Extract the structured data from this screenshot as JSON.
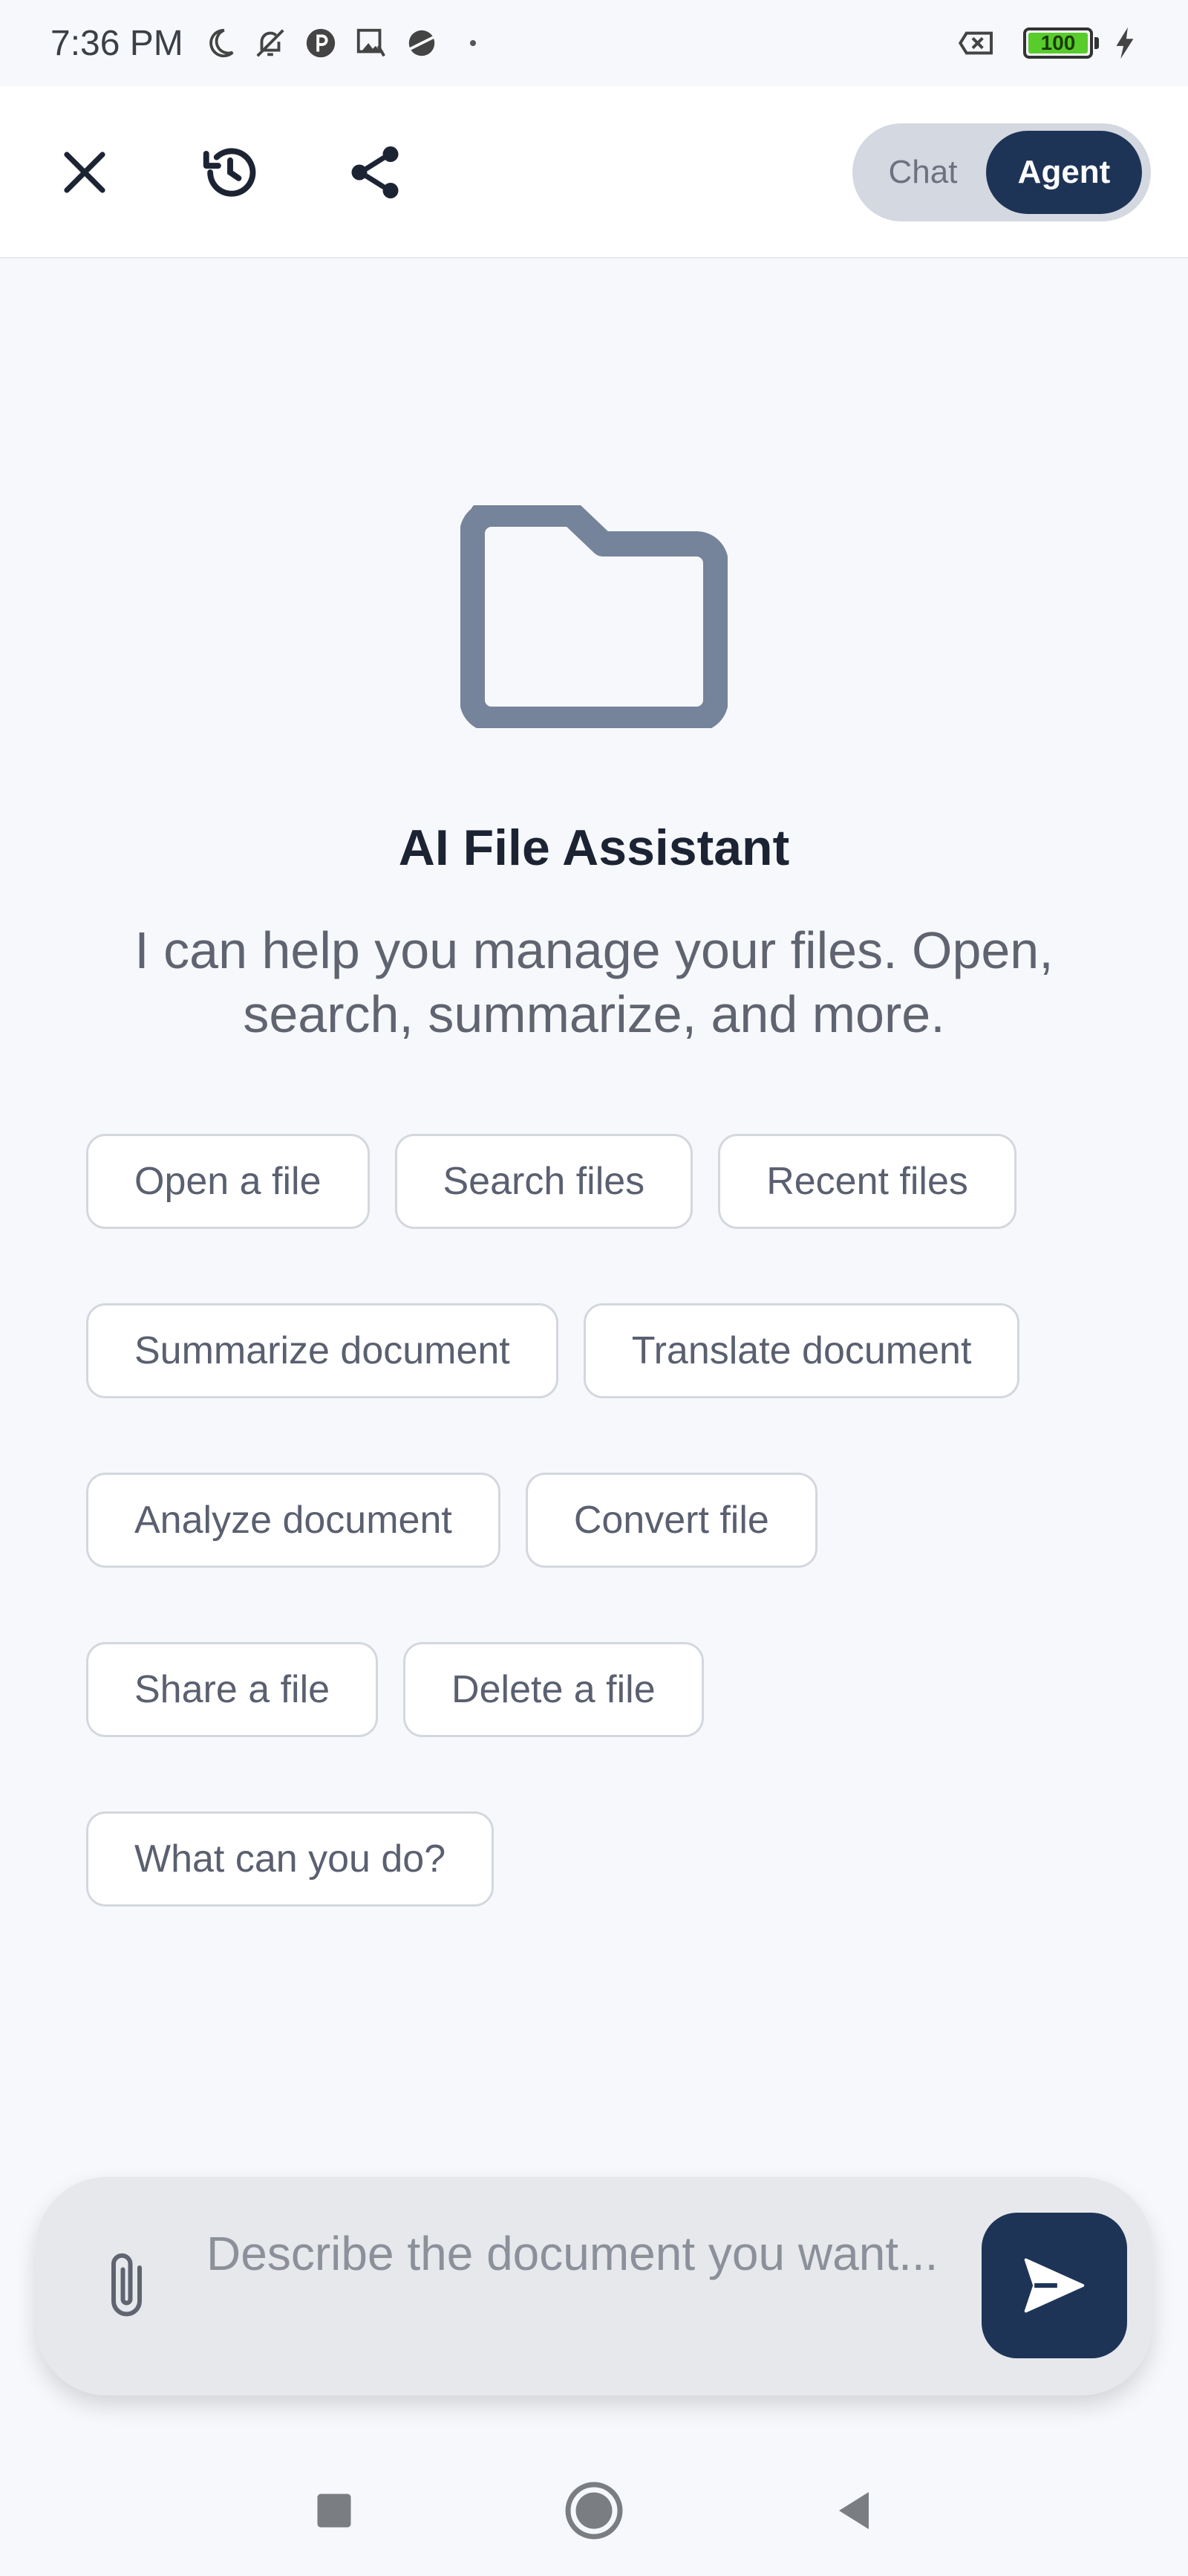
{
  "status_bar": {
    "time": "7:36 PM",
    "battery_level": "100",
    "icons": [
      "moon-icon",
      "bell-off-icon",
      "circle-p-icon",
      "image-icon",
      "planet-icon",
      "sim-off-icon",
      "charging-bolt-icon"
    ]
  },
  "app_bar": {
    "icons": [
      "close-icon",
      "history-icon",
      "share-icon"
    ],
    "mode_toggle": {
      "options": [
        "Chat",
        "Agent"
      ],
      "selected": "Agent"
    }
  },
  "hero": {
    "icon": "folder-icon",
    "title": "AI File Assistant",
    "subtitle": "I can help you manage your files. Open, search, summarize, and more."
  },
  "suggestions": [
    [
      "Open a file",
      "Search files",
      "Recent files"
    ],
    [
      "Summarize document",
      "Translate document"
    ],
    [
      "Analyze document",
      "Convert file"
    ],
    [
      "Share a file",
      "Delete a file"
    ],
    [
      "What can you do?"
    ]
  ],
  "composer": {
    "placeholder": "Describe the document you want...",
    "value": "",
    "attach_icon": "paperclip-icon",
    "send_icon": "send-icon"
  },
  "nav_bar": {
    "icons": [
      "recents-square-icon",
      "home-circle-icon",
      "back-triangle-icon"
    ]
  },
  "colors": {
    "background": "#f7f8fb",
    "accent": "#1e3457",
    "folder": "#75849b",
    "chip_border": "#d3d7de",
    "composer": "#e6e8ec"
  }
}
